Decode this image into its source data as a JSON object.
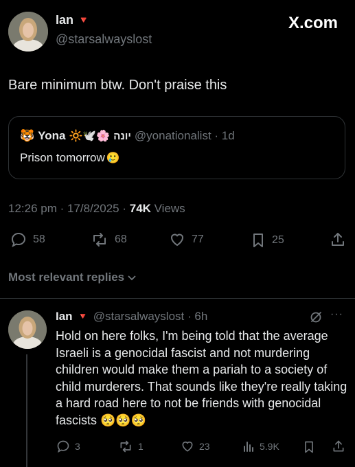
{
  "watermark": "X.com",
  "post": {
    "author_name": "Ian",
    "author_flag": "🔻",
    "handle": "@starsalwayslost",
    "text": "Bare minimum btw. Don't praise this",
    "quote": {
      "avatar_emoji": "🐯",
      "author_name": "Yona",
      "author_emojis": "🔆🕊️🌸",
      "hebrew_name": "יונה",
      "handle_time": "@yonationalist · 1d",
      "text": "Prison tomorrow",
      "text_emoji": "🥲"
    },
    "timestamp": "12:26 pm · 17/8/2025 · ",
    "views_count": "74K",
    "views_label": " Views",
    "stats": {
      "replies": "58",
      "reposts": "68",
      "likes": "77",
      "bookmarks": "25"
    }
  },
  "replies_sort_label": "Most relevant replies",
  "reply": {
    "author_name": "Ian",
    "author_flag": "🔻",
    "handle_time": "@starsalwayslost · 6h",
    "text": "Hold on here folks, I'm being told that the average Israeli is a genocidal fascist and not murdering children would make them a pariah to a society of child murderers. That sounds like they're really taking a hard road here to not be friends with genocidal fascists 🥺🥺🥺",
    "stats": {
      "replies": "3",
      "reposts": "1",
      "likes": "23",
      "views": "5.9K"
    }
  },
  "colors": {
    "background": "#000000",
    "text": "#e7e9ea",
    "muted": "#71767b",
    "border": "#2f3336",
    "flag": "#f4212e"
  }
}
